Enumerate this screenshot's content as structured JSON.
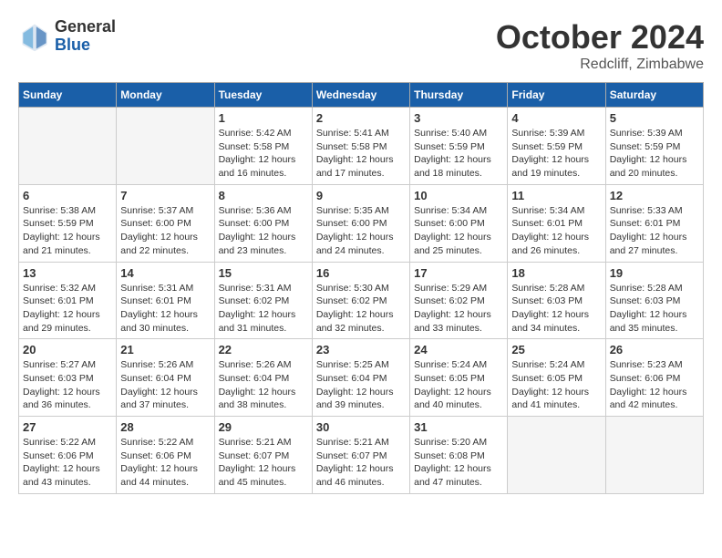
{
  "header": {
    "logo_general": "General",
    "logo_blue": "Blue",
    "month_title": "October 2024",
    "location": "Redcliff, Zimbabwe"
  },
  "weekdays": [
    "Sunday",
    "Monday",
    "Tuesday",
    "Wednesday",
    "Thursday",
    "Friday",
    "Saturday"
  ],
  "weeks": [
    [
      {
        "day": "",
        "empty": true
      },
      {
        "day": "",
        "empty": true
      },
      {
        "day": "1",
        "sunrise": "5:42 AM",
        "sunset": "5:58 PM",
        "daylight": "12 hours and 16 minutes."
      },
      {
        "day": "2",
        "sunrise": "5:41 AM",
        "sunset": "5:58 PM",
        "daylight": "12 hours and 17 minutes."
      },
      {
        "day": "3",
        "sunrise": "5:40 AM",
        "sunset": "5:59 PM",
        "daylight": "12 hours and 18 minutes."
      },
      {
        "day": "4",
        "sunrise": "5:39 AM",
        "sunset": "5:59 PM",
        "daylight": "12 hours and 19 minutes."
      },
      {
        "day": "5",
        "sunrise": "5:39 AM",
        "sunset": "5:59 PM",
        "daylight": "12 hours and 20 minutes."
      }
    ],
    [
      {
        "day": "6",
        "sunrise": "5:38 AM",
        "sunset": "5:59 PM",
        "daylight": "12 hours and 21 minutes."
      },
      {
        "day": "7",
        "sunrise": "5:37 AM",
        "sunset": "6:00 PM",
        "daylight": "12 hours and 22 minutes."
      },
      {
        "day": "8",
        "sunrise": "5:36 AM",
        "sunset": "6:00 PM",
        "daylight": "12 hours and 23 minutes."
      },
      {
        "day": "9",
        "sunrise": "5:35 AM",
        "sunset": "6:00 PM",
        "daylight": "12 hours and 24 minutes."
      },
      {
        "day": "10",
        "sunrise": "5:34 AM",
        "sunset": "6:00 PM",
        "daylight": "12 hours and 25 minutes."
      },
      {
        "day": "11",
        "sunrise": "5:34 AM",
        "sunset": "6:01 PM",
        "daylight": "12 hours and 26 minutes."
      },
      {
        "day": "12",
        "sunrise": "5:33 AM",
        "sunset": "6:01 PM",
        "daylight": "12 hours and 27 minutes."
      }
    ],
    [
      {
        "day": "13",
        "sunrise": "5:32 AM",
        "sunset": "6:01 PM",
        "daylight": "12 hours and 29 minutes."
      },
      {
        "day": "14",
        "sunrise": "5:31 AM",
        "sunset": "6:01 PM",
        "daylight": "12 hours and 30 minutes."
      },
      {
        "day": "15",
        "sunrise": "5:31 AM",
        "sunset": "6:02 PM",
        "daylight": "12 hours and 31 minutes."
      },
      {
        "day": "16",
        "sunrise": "5:30 AM",
        "sunset": "6:02 PM",
        "daylight": "12 hours and 32 minutes."
      },
      {
        "day": "17",
        "sunrise": "5:29 AM",
        "sunset": "6:02 PM",
        "daylight": "12 hours and 33 minutes."
      },
      {
        "day": "18",
        "sunrise": "5:28 AM",
        "sunset": "6:03 PM",
        "daylight": "12 hours and 34 minutes."
      },
      {
        "day": "19",
        "sunrise": "5:28 AM",
        "sunset": "6:03 PM",
        "daylight": "12 hours and 35 minutes."
      }
    ],
    [
      {
        "day": "20",
        "sunrise": "5:27 AM",
        "sunset": "6:03 PM",
        "daylight": "12 hours and 36 minutes."
      },
      {
        "day": "21",
        "sunrise": "5:26 AM",
        "sunset": "6:04 PM",
        "daylight": "12 hours and 37 minutes."
      },
      {
        "day": "22",
        "sunrise": "5:26 AM",
        "sunset": "6:04 PM",
        "daylight": "12 hours and 38 minutes."
      },
      {
        "day": "23",
        "sunrise": "5:25 AM",
        "sunset": "6:04 PM",
        "daylight": "12 hours and 39 minutes."
      },
      {
        "day": "24",
        "sunrise": "5:24 AM",
        "sunset": "6:05 PM",
        "daylight": "12 hours and 40 minutes."
      },
      {
        "day": "25",
        "sunrise": "5:24 AM",
        "sunset": "6:05 PM",
        "daylight": "12 hours and 41 minutes."
      },
      {
        "day": "26",
        "sunrise": "5:23 AM",
        "sunset": "6:06 PM",
        "daylight": "12 hours and 42 minutes."
      }
    ],
    [
      {
        "day": "27",
        "sunrise": "5:22 AM",
        "sunset": "6:06 PM",
        "daylight": "12 hours and 43 minutes."
      },
      {
        "day": "28",
        "sunrise": "5:22 AM",
        "sunset": "6:06 PM",
        "daylight": "12 hours and 44 minutes."
      },
      {
        "day": "29",
        "sunrise": "5:21 AM",
        "sunset": "6:07 PM",
        "daylight": "12 hours and 45 minutes."
      },
      {
        "day": "30",
        "sunrise": "5:21 AM",
        "sunset": "6:07 PM",
        "daylight": "12 hours and 46 minutes."
      },
      {
        "day": "31",
        "sunrise": "5:20 AM",
        "sunset": "6:08 PM",
        "daylight": "12 hours and 47 minutes."
      },
      {
        "day": "",
        "empty": true
      },
      {
        "day": "",
        "empty": true
      }
    ]
  ]
}
